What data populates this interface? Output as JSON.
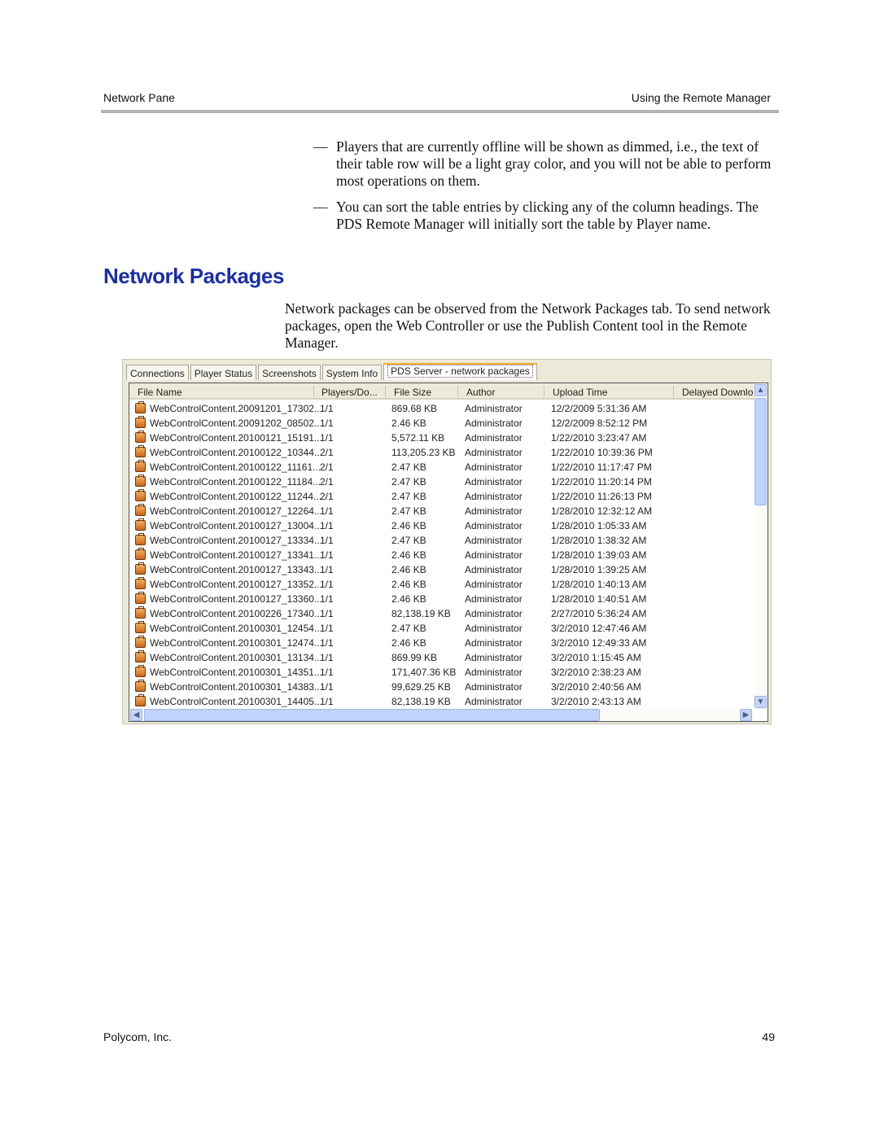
{
  "header": {
    "left": "Network Pane",
    "right": "Using the Remote Manager"
  },
  "bullets": [
    "Players that are currently offline will be shown as dimmed, i.e., the text of their table row will be a light gray color, and you will not be able to perform most operations on them.",
    "You can sort the table entries by clicking any of the column headings. The PDS Remote Manager will initially sort the table by Player name."
  ],
  "bullet_marker": "—",
  "section_title": "Network Packages",
  "paragraph": "Network packages can be observed from the Network Packages tab. To send network packages, open the Web Controller or use the Publish Content tool in the Remote Manager.",
  "screenshot": {
    "tabs": [
      "Connections",
      "Player Status",
      "Screenshots",
      "System Info",
      "PDS Server - network packages"
    ],
    "active_tab": "PDS Server - network packages",
    "columns": [
      "File Name",
      "Players/Do...",
      "File Size",
      "Author",
      "Upload Time",
      "Delayed Downloa"
    ],
    "rows": [
      [
        "WebControlContent.20091201_17302...",
        "1/1",
        "869.68 KB",
        "Administrator",
        "12/2/2009 5:31:36 AM"
      ],
      [
        "WebControlContent.20091202_08502...",
        "1/1",
        "2.46 KB",
        "Administrator",
        "12/2/2009 8:52:12 PM"
      ],
      [
        "WebControlContent.20100121_15191...",
        "1/1",
        "5,572.11 KB",
        "Administrator",
        "1/22/2010 3:23:47 AM"
      ],
      [
        "WebControlContent.20100122_10344...",
        "2/1",
        "113,205.23 KB",
        "Administrator",
        "1/22/2010 10:39:36 PM"
      ],
      [
        "WebControlContent.20100122_11161...",
        "2/1",
        "2.47 KB",
        "Administrator",
        "1/22/2010 11:17:47 PM"
      ],
      [
        "WebControlContent.20100122_11184...",
        "2/1",
        "2.47 KB",
        "Administrator",
        "1/22/2010 11:20:14 PM"
      ],
      [
        "WebControlContent.20100122_11244...",
        "2/1",
        "2.47 KB",
        "Administrator",
        "1/22/2010 11:26:13 PM"
      ],
      [
        "WebControlContent.20100127_12264...",
        "1/1",
        "2.47 KB",
        "Administrator",
        "1/28/2010 12:32:12 AM"
      ],
      [
        "WebControlContent.20100127_13004...",
        "1/1",
        "2.46 KB",
        "Administrator",
        "1/28/2010 1:05:33 AM"
      ],
      [
        "WebControlContent.20100127_13334...",
        "1/1",
        "2.47 KB",
        "Administrator",
        "1/28/2010 1:38:32 AM"
      ],
      [
        "WebControlContent.20100127_13341...",
        "1/1",
        "2.46 KB",
        "Administrator",
        "1/28/2010 1:39:03 AM"
      ],
      [
        "WebControlContent.20100127_13343...",
        "1/1",
        "2.46 KB",
        "Administrator",
        "1/28/2010 1:39:25 AM"
      ],
      [
        "WebControlContent.20100127_13352...",
        "1/1",
        "2.46 KB",
        "Administrator",
        "1/28/2010 1:40:13 AM"
      ],
      [
        "WebControlContent.20100127_13360...",
        "1/1",
        "2.46 KB",
        "Administrator",
        "1/28/2010 1:40:51 AM"
      ],
      [
        "WebControlContent.20100226_17340...",
        "1/1",
        "82,138.19 KB",
        "Administrator",
        "2/27/2010 5:36:24 AM"
      ],
      [
        "WebControlContent.20100301_12454...",
        "1/1",
        "2.47 KB",
        "Administrator",
        "3/2/2010 12:47:46 AM"
      ],
      [
        "WebControlContent.20100301_12474...",
        "1/1",
        "2.46 KB",
        "Administrator",
        "3/2/2010 12:49:33 AM"
      ],
      [
        "WebControlContent.20100301_13134...",
        "1/1",
        "869.99 KB",
        "Administrator",
        "3/2/2010 1:15:45 AM"
      ],
      [
        "WebControlContent.20100301_14351...",
        "1/1",
        "171,407.36 KB",
        "Administrator",
        "3/2/2010 2:38:23 AM"
      ],
      [
        "WebControlContent.20100301_14383...",
        "1/1",
        "99,629.25 KB",
        "Administrator",
        "3/2/2010 2:40:56 AM"
      ],
      [
        "WebControlContent.20100301_14405...",
        "1/1",
        "82,138.19 KB",
        "Administrator",
        "3/2/2010 2:43:13 AM"
      ]
    ],
    "icons": {
      "row": "package-icon",
      "up": "scroll-up-icon",
      "down": "scroll-down-icon",
      "left": "scroll-left-icon",
      "right": "scroll-right-icon"
    }
  },
  "footer": {
    "left": "Polycom, Inc.",
    "right": "49"
  }
}
